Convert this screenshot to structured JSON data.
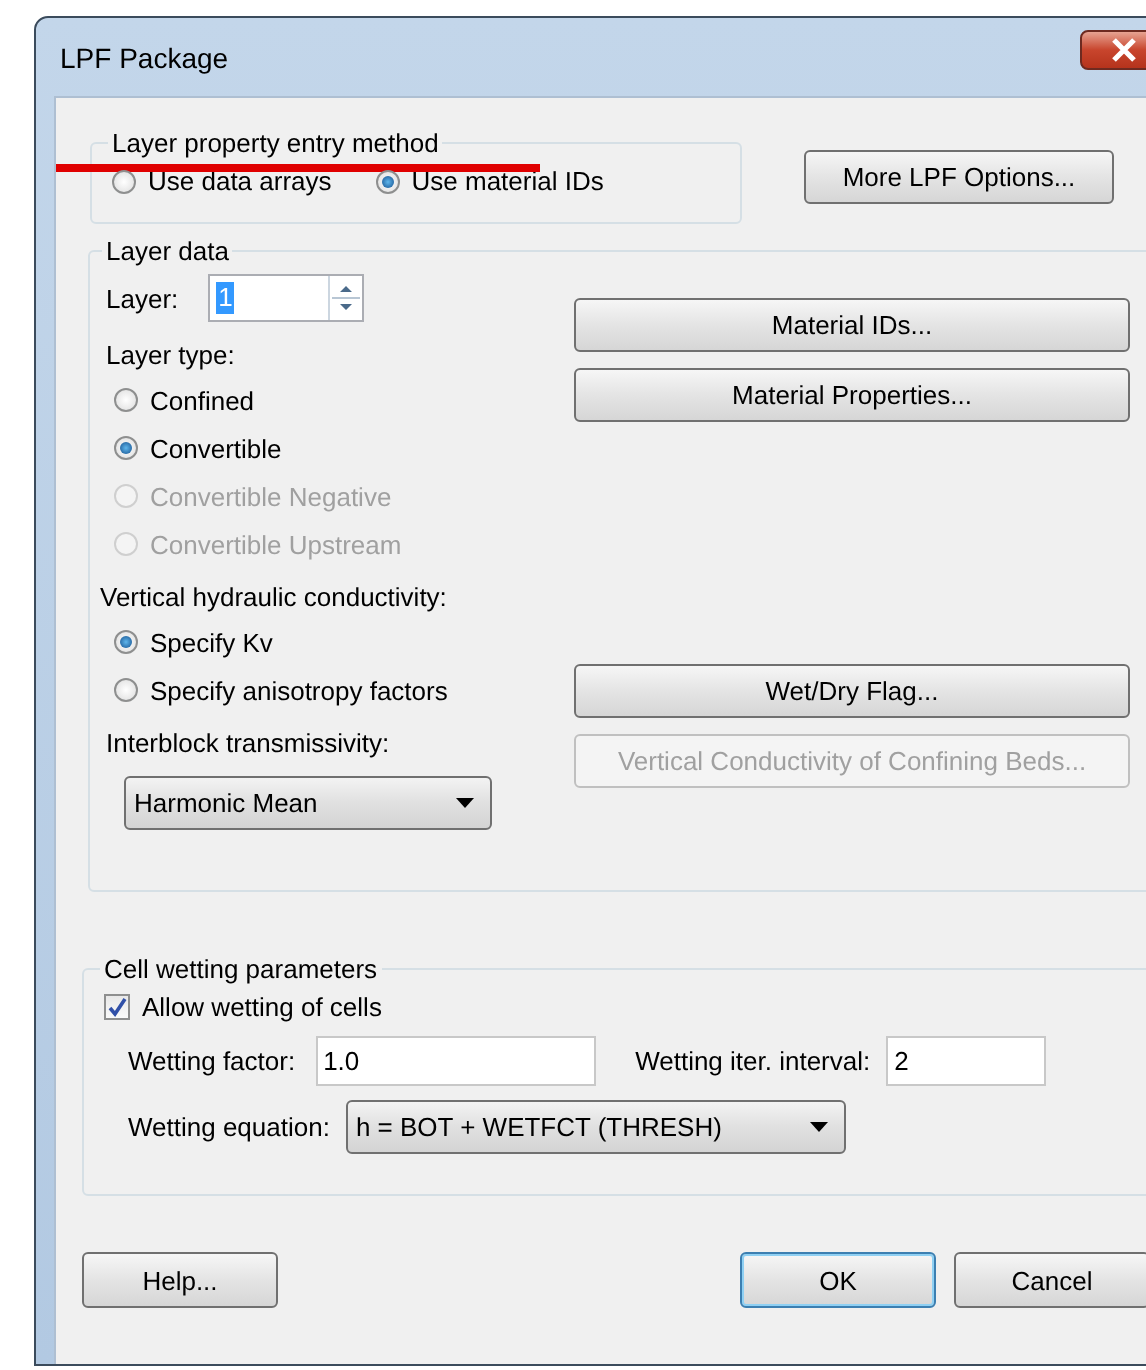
{
  "window": {
    "title": "LPF Package"
  },
  "entry_method": {
    "legend": "Layer property entry method",
    "options": [
      {
        "label": "Use data arrays",
        "selected": false
      },
      {
        "label": "Use material IDs",
        "selected": true
      }
    ]
  },
  "more_options_button": "More LPF Options...",
  "layer_data": {
    "legend": "Layer data",
    "layer_label": "Layer:",
    "layer_value": "1",
    "layer_value_highlighted": true,
    "layer_type_label": "Layer type:",
    "layer_types": [
      {
        "label": "Confined",
        "selected": false,
        "disabled": false
      },
      {
        "label": "Convertible",
        "selected": true,
        "disabled": false
      },
      {
        "label": "Convertible Negative",
        "selected": false,
        "disabled": true
      },
      {
        "label": "Convertible Upstream",
        "selected": false,
        "disabled": true
      }
    ],
    "vk_label": "Vertical hydraulic conductivity:",
    "vk_options": [
      {
        "label": "Specify Kv",
        "selected": true,
        "disabled": false
      },
      {
        "label": "Specify anisotropy factors",
        "selected": false,
        "disabled": false
      }
    ],
    "interblock_label": "Interblock transmissivity:",
    "interblock_value": "Harmonic Mean",
    "buttons_top": [
      {
        "label": "Material IDs...",
        "disabled": false
      },
      {
        "label": "Material Properties...",
        "disabled": false
      }
    ],
    "buttons_bottom": [
      {
        "label": "Wet/Dry Flag...",
        "disabled": false
      },
      {
        "label": "Vertical Conductivity of Confining Beds...",
        "disabled": true
      }
    ]
  },
  "cell_wetting": {
    "legend": "Cell wetting parameters",
    "allow": {
      "label": "Allow wetting of cells",
      "checked": true
    },
    "factor": {
      "label": "Wetting factor:",
      "value": "1.0"
    },
    "interval": {
      "label": "Wetting iter. interval:",
      "value": "2"
    },
    "equation": {
      "label": "Wetting equation:",
      "value": "h = BOT + WETFCT (THRESH)"
    }
  },
  "footer_buttons": [
    {
      "label": "Help...",
      "default": false
    },
    {
      "label": "OK",
      "default": true
    },
    {
      "label": "Cancel",
      "default": false
    }
  ]
}
